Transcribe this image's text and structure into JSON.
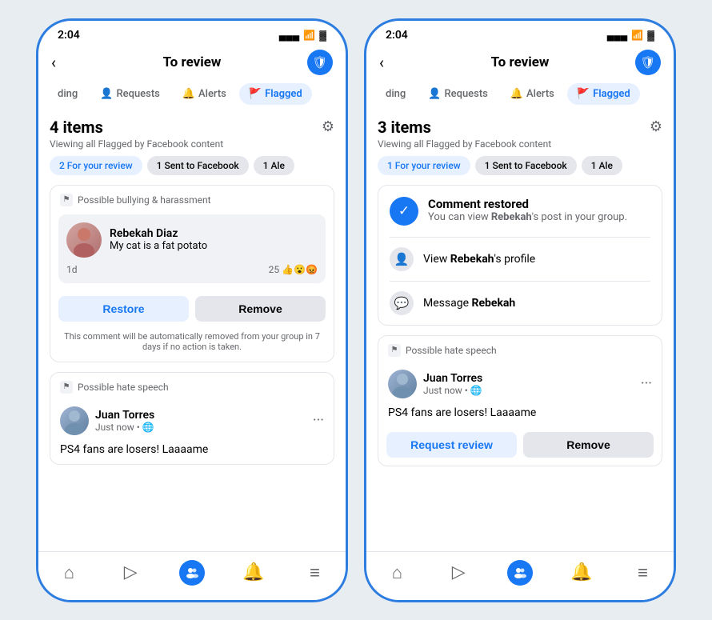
{
  "phone1": {
    "statusBar": {
      "time": "2:04",
      "signal": "▲▲▲",
      "wifi": "WiFi",
      "battery": "🔋"
    },
    "header": {
      "back": "‹",
      "title": "To review",
      "shield": "🛡"
    },
    "tabs": [
      {
        "label": "ding",
        "active": false
      },
      {
        "label": "Requests",
        "active": false,
        "icon": "👤"
      },
      {
        "label": "Alerts",
        "active": false,
        "icon": "🔔"
      },
      {
        "label": "Flagged",
        "active": true,
        "icon": "🚩"
      }
    ],
    "itemsHeader": {
      "title": "4 items",
      "subtitle": "Viewing all Flagged by Facebook content",
      "gear": "⚙"
    },
    "chips": [
      {
        "label": "2 For your review",
        "type": "blue"
      },
      {
        "label": "1 Sent to Facebook",
        "type": "gray"
      },
      {
        "label": "1 Ale",
        "type": "gray"
      }
    ],
    "card1": {
      "category": "Possible bullying & harassment",
      "user": {
        "name": "Rebekah Diaz",
        "text": "My cat is a fat potato"
      },
      "meta": {
        "time": "1d",
        "reactionCount": "25",
        "reactions": "👍😮😡"
      },
      "actions": {
        "restore": "Restore",
        "remove": "Remove"
      },
      "note": "This comment will be automatically removed from your group in 7 days if no action is taken."
    },
    "card2": {
      "category": "Possible hate speech",
      "user": {
        "name": "Juan Torres",
        "meta": "Just now • 🌐"
      },
      "text": "PS4 fans are losers! Laaaame"
    }
  },
  "phone2": {
    "statusBar": {
      "time": "2:04"
    },
    "header": {
      "back": "‹",
      "title": "To review",
      "shield": "🛡"
    },
    "tabs": [
      {
        "label": "ding",
        "active": false
      },
      {
        "label": "Requests",
        "active": false,
        "icon": "👤"
      },
      {
        "label": "Alerts",
        "active": false,
        "icon": "🔔"
      },
      {
        "label": "Flagged",
        "active": true,
        "icon": "🚩"
      }
    ],
    "itemsHeader": {
      "title": "3 items",
      "subtitle": "Viewing all Flagged by Facebook content",
      "gear": "⚙"
    },
    "chips": [
      {
        "label": "1 For your review",
        "type": "blue"
      },
      {
        "label": "1 Sent to Facebook",
        "type": "gray"
      },
      {
        "label": "1 Ale",
        "type": "gray"
      }
    ],
    "restored": {
      "title": "Comment restored",
      "subtitle": "You can view Rebekah's post in your group.",
      "actions": [
        {
          "label": "View Rebekah's profile",
          "icon": "👤"
        },
        {
          "label": "Message Rebekah",
          "icon": "💬"
        }
      ]
    },
    "card2": {
      "category": "Possible hate speech",
      "user": {
        "name": "Juan Torres",
        "meta": "Just now • 🌐"
      },
      "text": "PS4 fans are losers! Laaaame",
      "actions": {
        "review": "Request review",
        "remove": "Remove"
      }
    }
  }
}
